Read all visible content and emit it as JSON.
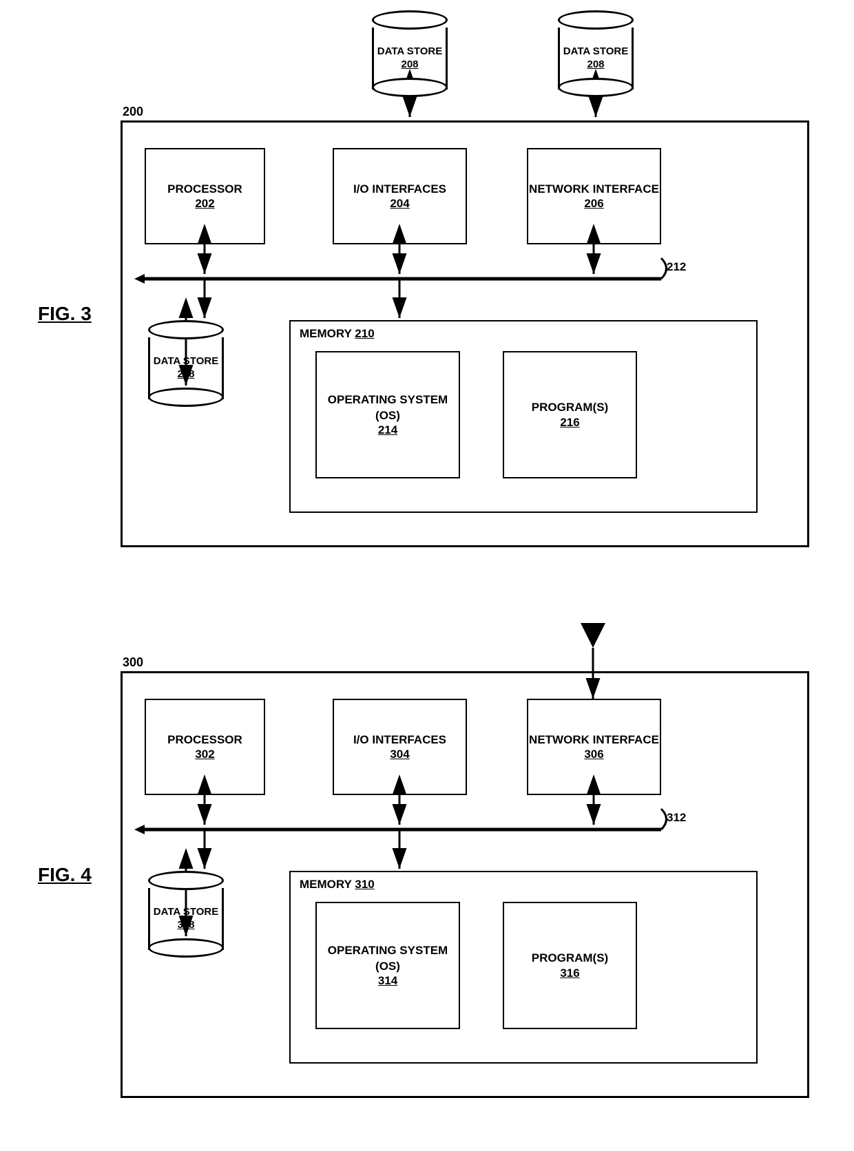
{
  "fig3": {
    "label": "FIG. 3",
    "system": {
      "label": "200"
    },
    "processor": {
      "name": "PROCESSOR",
      "ref": "202"
    },
    "io": {
      "name": "I/O\nINTERFACES",
      "ref": "204"
    },
    "network": {
      "name": "NETWORK\nINTERFACE",
      "ref": "206"
    },
    "bus": {
      "ref": "212"
    },
    "memory": {
      "name": "MEMORY ",
      "ref": "210"
    },
    "os": {
      "name": "OPERATING\nSYSTEM (OS)",
      "ref": "214"
    },
    "programs": {
      "name": "PROGRAM(S)",
      "ref": "216"
    },
    "datastore_bottom": {
      "name": "DATA STORE",
      "ref": "208"
    },
    "datastore_top1": {
      "name": "DATA STORE",
      "ref": "208"
    },
    "datastore_top2": {
      "name": "DATA STORE",
      "ref": "208"
    }
  },
  "fig4": {
    "label": "FIG. 4",
    "system": {
      "label": "300"
    },
    "processor": {
      "name": "PROCESSOR",
      "ref": "302"
    },
    "io": {
      "name": "I/O\nINTERFACES",
      "ref": "304"
    },
    "network": {
      "name": "NETWORK\nINTERFACE",
      "ref": "306"
    },
    "bus": {
      "ref": "312"
    },
    "memory": {
      "name": "MEMORY ",
      "ref": "310"
    },
    "os": {
      "name": "OPERATING\nSYSTEM (OS)",
      "ref": "314"
    },
    "programs": {
      "name": "PROGRAM(S)",
      "ref": "316"
    },
    "datastore_bottom": {
      "name": "DATA STORE",
      "ref": "308"
    }
  }
}
